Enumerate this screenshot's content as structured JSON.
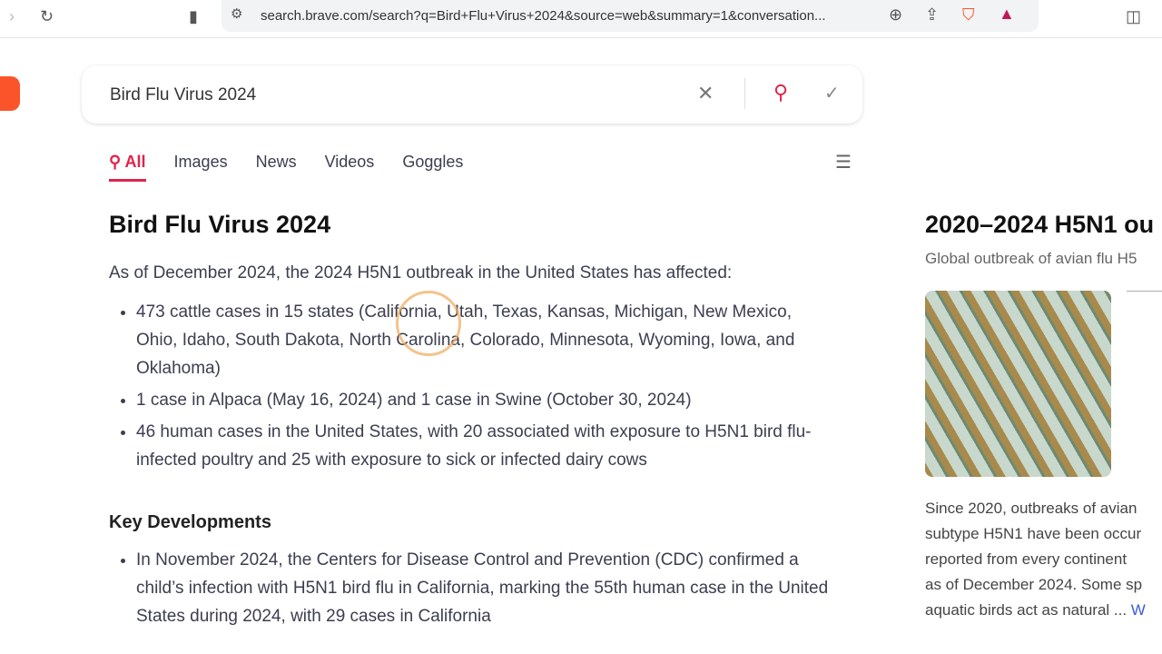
{
  "browser": {
    "url": "search.brave.com/search?q=Bird+Flu+Virus+2024&source=web&summary=1&conversation..."
  },
  "search": {
    "query": "Bird Flu Virus 2024"
  },
  "tabs": [
    {
      "label": "All"
    },
    {
      "label": "Images"
    },
    {
      "label": "News"
    },
    {
      "label": "Videos"
    },
    {
      "label": "Goggles"
    }
  ],
  "main": {
    "title": "Bird Flu Virus 2024",
    "intro": "As of December 2024, the 2024 H5N1 outbreak in the United States has affected:",
    "bullets": [
      "473 cattle cases in 15 states (California, Utah, Texas, Kansas, Michigan, New Mexico, Ohio, Idaho, South Dakota, North Carolina, Colorado, Minnesota, Wyoming, Iowa, and Oklahoma)",
      "1 case in Alpaca (May 16, 2024) and 1 case in Swine (October 30, 2024)",
      "46 human cases in the United States, with 20 associated with exposure to H5N1 bird flu-infected poultry and 25 with exposure to sick or infected dairy cows"
    ],
    "section2": "Key Developments",
    "bullets2": [
      "In November 2024, the Centers for Disease Control and Prevention (CDC) confirmed a child’s infection with H5N1 bird flu in California, marking the 55th human case in the United States during 2024, with 29 cases in California"
    ]
  },
  "side": {
    "title": "2020–2024 H5N1 ou",
    "subtitle": "Global outbreak of avian flu H5",
    "desc": [
      "Since 2020, outbreaks of avian",
      "subtype H5N1 have been occur",
      "reported from every continent",
      "as of December 2024. Some sp",
      "aquatic birds act as natural ..."
    ],
    "more": "W"
  },
  "colors": {
    "accent": "#e0234b"
  }
}
